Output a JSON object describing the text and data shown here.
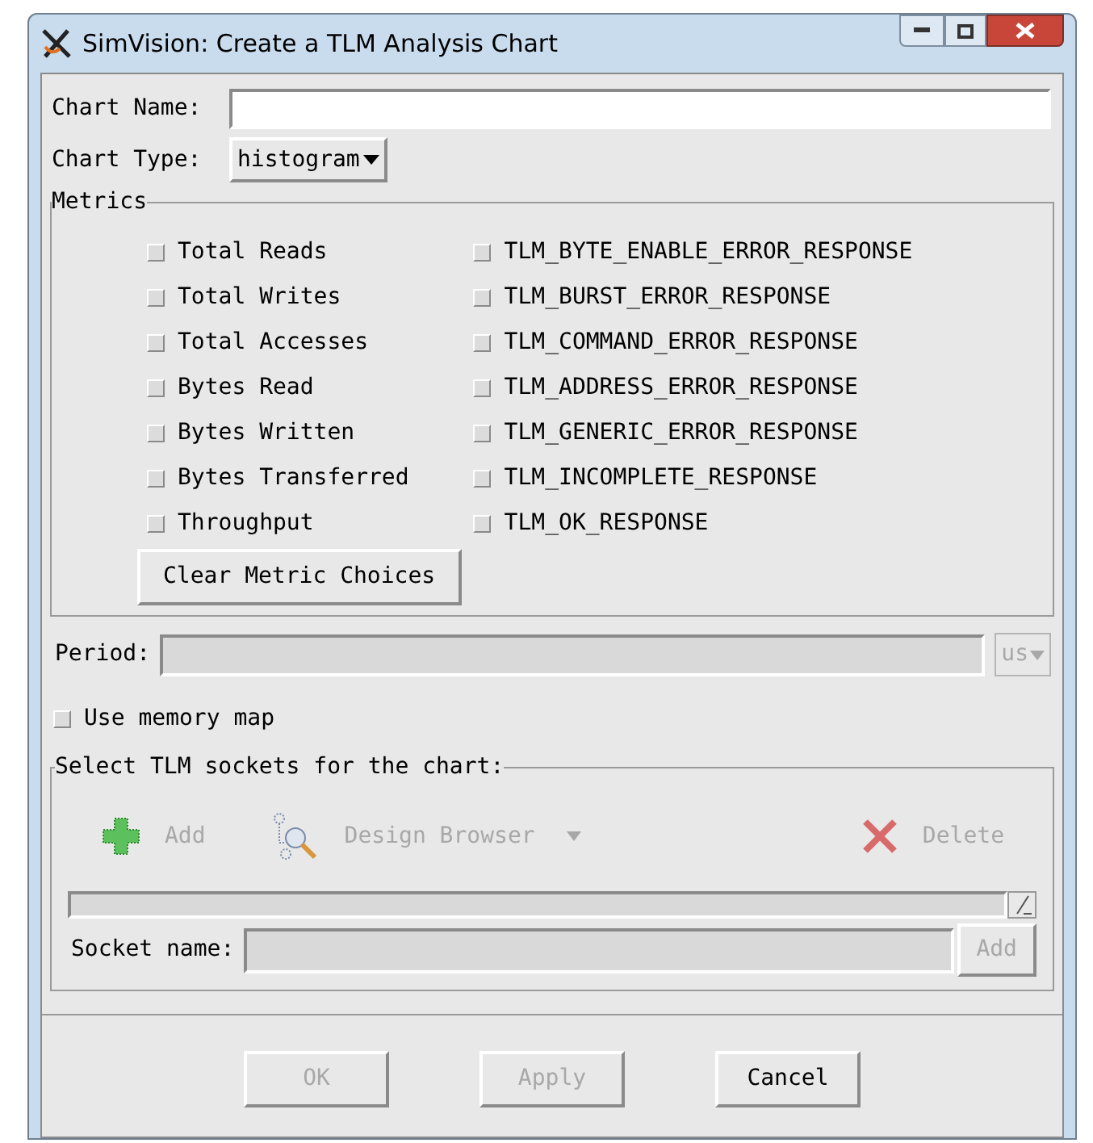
{
  "window": {
    "title": "SimVision: Create a TLM Analysis Chart"
  },
  "chart_name": {
    "label": "Chart Name:"
  },
  "chart_type": {
    "label": "Chart Type:",
    "value": "histogram"
  },
  "metrics": {
    "title": "Metrics",
    "left": [
      {
        "label": "Total Reads",
        "checked": false
      },
      {
        "label": "Total Writes",
        "checked": false
      },
      {
        "label": "Total Accesses",
        "checked": false
      },
      {
        "label": "Bytes Read",
        "checked": false
      },
      {
        "label": "Bytes Written",
        "checked": false
      },
      {
        "label": "Bytes Transferred",
        "checked": false
      },
      {
        "label": "Throughput",
        "checked": false
      }
    ],
    "right": [
      {
        "label": "TLM_BYTE_ENABLE_ERROR_RESPONSE",
        "checked": false
      },
      {
        "label": "TLM_BURST_ERROR_RESPONSE",
        "checked": false
      },
      {
        "label": "TLM_COMMAND_ERROR_RESPONSE",
        "checked": false
      },
      {
        "label": "TLM_ADDRESS_ERROR_RESPONSE",
        "checked": false
      },
      {
        "label": "TLM_GENERIC_ERROR_RESPONSE",
        "checked": false
      },
      {
        "label": "TLM_INCOMPLETE_RESPONSE",
        "checked": false
      },
      {
        "label": "TLM_OK_RESPONSE",
        "checked": false
      }
    ],
    "clear_button": "Clear Metric Choices"
  },
  "period": {
    "label": "Period:",
    "unit": "us",
    "disabled": true
  },
  "use_memory_map": {
    "label": "Use memory map",
    "checked": false
  },
  "sockets": {
    "title": "Select TLM sockets for the chart:",
    "toolbar": [
      {
        "kind": "add",
        "label": "Add",
        "disabled": true
      },
      {
        "kind": "browser",
        "label": "Design Browser",
        "disabled": true
      },
      {
        "kind": "delete",
        "label": "Delete",
        "disabled": true
      }
    ],
    "socket_name": {
      "label": "Socket name:",
      "disabled": true
    },
    "add_button": {
      "label": "Add",
      "disabled": true
    }
  },
  "buttons": [
    {
      "label": "OK",
      "disabled": true
    },
    {
      "label": "Apply",
      "disabled": true
    },
    {
      "label": "Cancel",
      "disabled": false
    }
  ]
}
